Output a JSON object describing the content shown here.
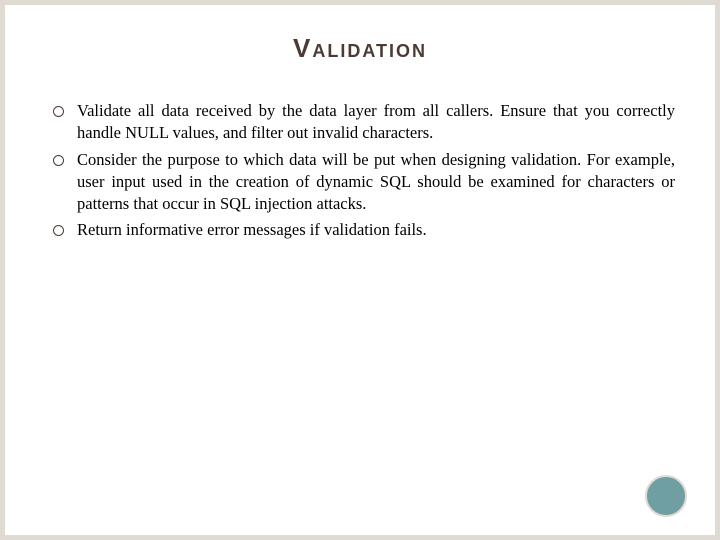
{
  "title": "Validation",
  "bullets": [
    "Validate all data received by the data layer from all callers. Ensure that you correctly handle NULL values, and filter out invalid characters.",
    "Consider the purpose to which data will be put when designing validation. For example, user input used in the creation of dynamic SQL should be examined for characters or patterns that occur in SQL injection attacks.",
    "Return informative error messages if validation fails."
  ]
}
